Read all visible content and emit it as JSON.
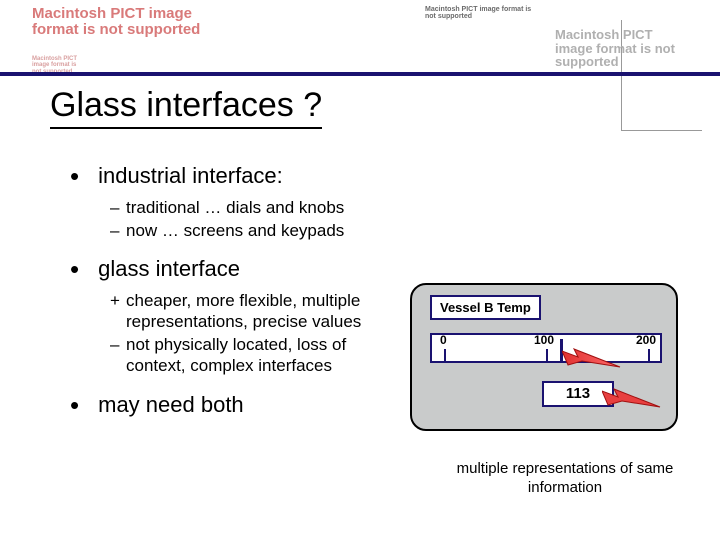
{
  "placeholders": {
    "big1": "Macintosh PICT image format is not supported",
    "small": "Macintosh PICT image format is not supported",
    "right": "Macintosh PICT image format is not supported"
  },
  "title": "Glass interfaces ?",
  "bullets": {
    "b1": "industrial interface:",
    "b1a": "traditional … dials and knobs",
    "b1b": "now … screens and keypads",
    "b2": "glass interface",
    "b2a": "cheaper, more flexible, multiple representations, precise values",
    "b2b": "not physically located, loss of context, complex interfaces",
    "b3": "may need both"
  },
  "figure": {
    "vessel_label": "Vessel B Temp",
    "ticks": {
      "t0": "0",
      "t1": "100",
      "t2": "200"
    },
    "value": "113",
    "caption": "multiple representations of same information"
  }
}
